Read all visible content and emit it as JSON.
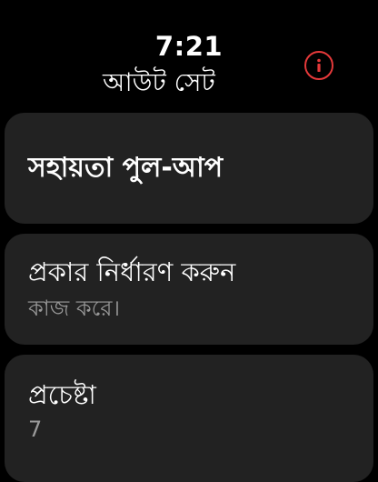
{
  "status_bar": {
    "time": "7:21"
  },
  "header": {
    "title": "আউট সেট",
    "info_icon": "info-icon",
    "accent_color": "#e5393a"
  },
  "cards": {
    "pullup": {
      "label": "সহায়তা পুল-আপ"
    },
    "type": {
      "label": "প্রকার নির্ধারণ করুন",
      "value": "কাজ করে।"
    },
    "attempt": {
      "label": "প্রচেষ্টা",
      "value": "7"
    }
  }
}
